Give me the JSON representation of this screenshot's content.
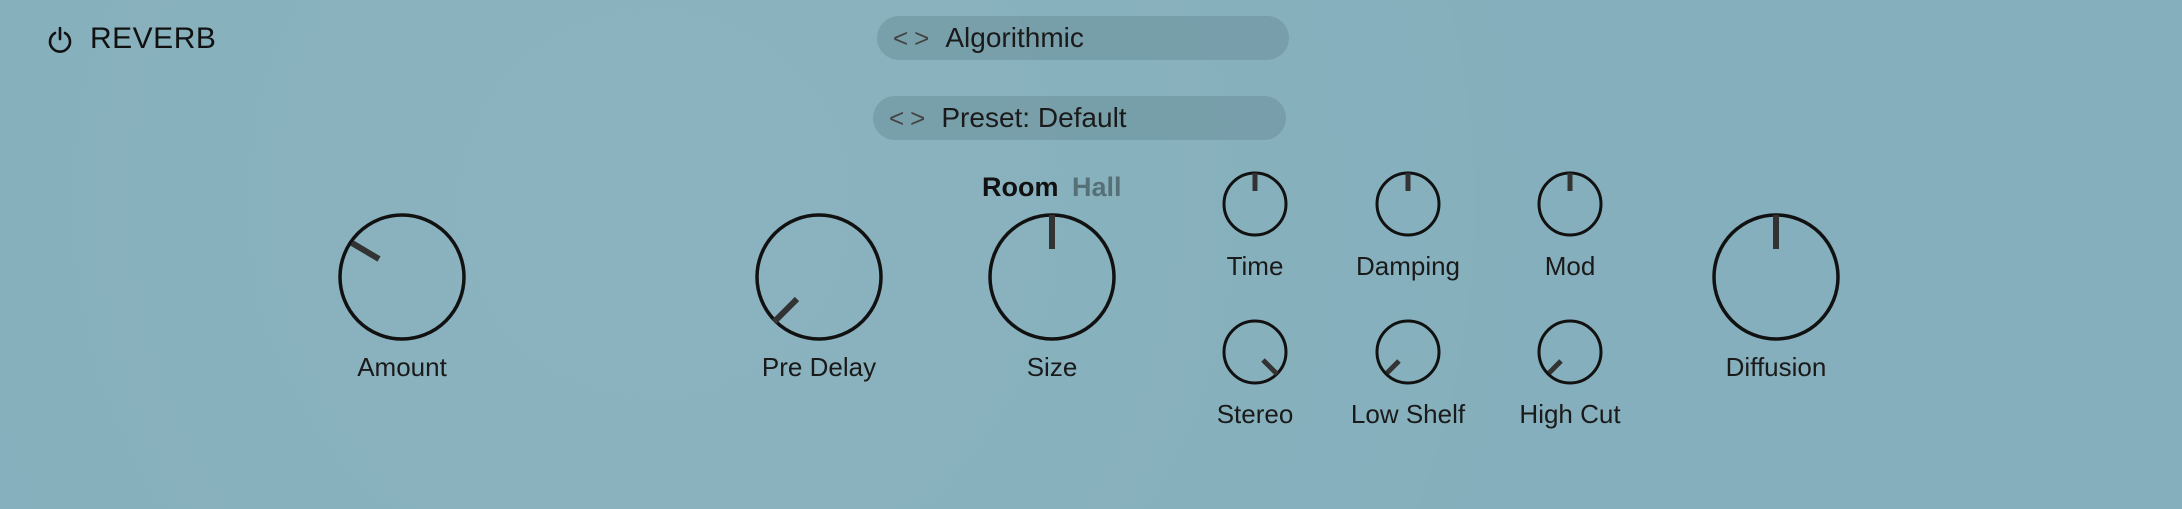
{
  "header": {
    "title": "REVERB",
    "power_icon": "power-icon"
  },
  "algorithm_selector": {
    "label": "Algorithmic",
    "nav_icon": "prev-next-arrows-icon"
  },
  "preset_selector": {
    "label": "Preset: Default",
    "nav_icon": "prev-next-arrows-icon"
  },
  "mode_toggle": {
    "options": [
      "Room",
      "Hall"
    ],
    "selected": "Room"
  },
  "knobs": {
    "amount": {
      "label": "Amount"
    },
    "pre_delay": {
      "label": "Pre Delay"
    },
    "size": {
      "label": "Size"
    },
    "time": {
      "label": "Time"
    },
    "damping": {
      "label": "Damping"
    },
    "mod": {
      "label": "Mod"
    },
    "stereo": {
      "label": "Stereo"
    },
    "low_shelf": {
      "label": "Low Shelf"
    },
    "high_cut": {
      "label": "High Cut"
    },
    "diffusion": {
      "label": "Diffusion"
    }
  },
  "colors": {
    "background": "#85afbc",
    "knob_stroke": "#111111",
    "indicator": "#333333"
  }
}
